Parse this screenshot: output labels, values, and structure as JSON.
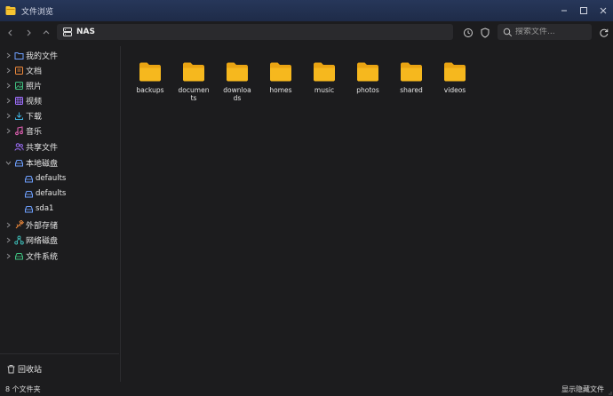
{
  "window": {
    "title": "文件浏览"
  },
  "toolbar": {
    "path_label": "NAS",
    "search_placeholder": "搜索文件..."
  },
  "sidebar": {
    "items": [
      {
        "label": "我的文件",
        "icon": "folder-icon",
        "color": "#6ea0ff"
      },
      {
        "label": "文档",
        "icon": "document-icon",
        "color": "#f08a3c"
      },
      {
        "label": "照片",
        "icon": "image-icon",
        "color": "#3fbf7f"
      },
      {
        "label": "视频",
        "icon": "video-icon",
        "color": "#a070ff"
      },
      {
        "label": "下载",
        "icon": "download-icon",
        "color": "#3fb2e0"
      },
      {
        "label": "音乐",
        "icon": "music-icon",
        "color": "#e862b8"
      },
      {
        "label": "共享文件",
        "icon": "users-icon",
        "color": "#a070ff"
      },
      {
        "label": "本地磁盘",
        "icon": "drive-icon",
        "color": "#6ea0ff"
      },
      {
        "label": "defaults",
        "icon": "drive-icon",
        "color": "#6ea0ff"
      },
      {
        "label": "defaults",
        "icon": "drive-icon",
        "color": "#6ea0ff"
      },
      {
        "label": "sda1",
        "icon": "drive-icon",
        "color": "#6ea0ff"
      },
      {
        "label": "外部存储",
        "icon": "usb-icon",
        "color": "#f08a3c"
      },
      {
        "label": "网络磁盘",
        "icon": "network-icon",
        "color": "#3fc6c0"
      },
      {
        "label": "文件系统",
        "icon": "drive-icon",
        "color": "#3fbf7f"
      }
    ],
    "trash_label": "回收站"
  },
  "folders": [
    "backups",
    "documents",
    "downloads",
    "homes",
    "music",
    "photos",
    "shared",
    "videos"
  ],
  "status": {
    "count": "8 个文件夹",
    "show_hidden": "显示隐藏文件"
  },
  "colors": {
    "folder": "#f6b81e",
    "folder_tab": "#e9a413",
    "titlebar": "#24345a",
    "background": "#1c1c1e"
  }
}
